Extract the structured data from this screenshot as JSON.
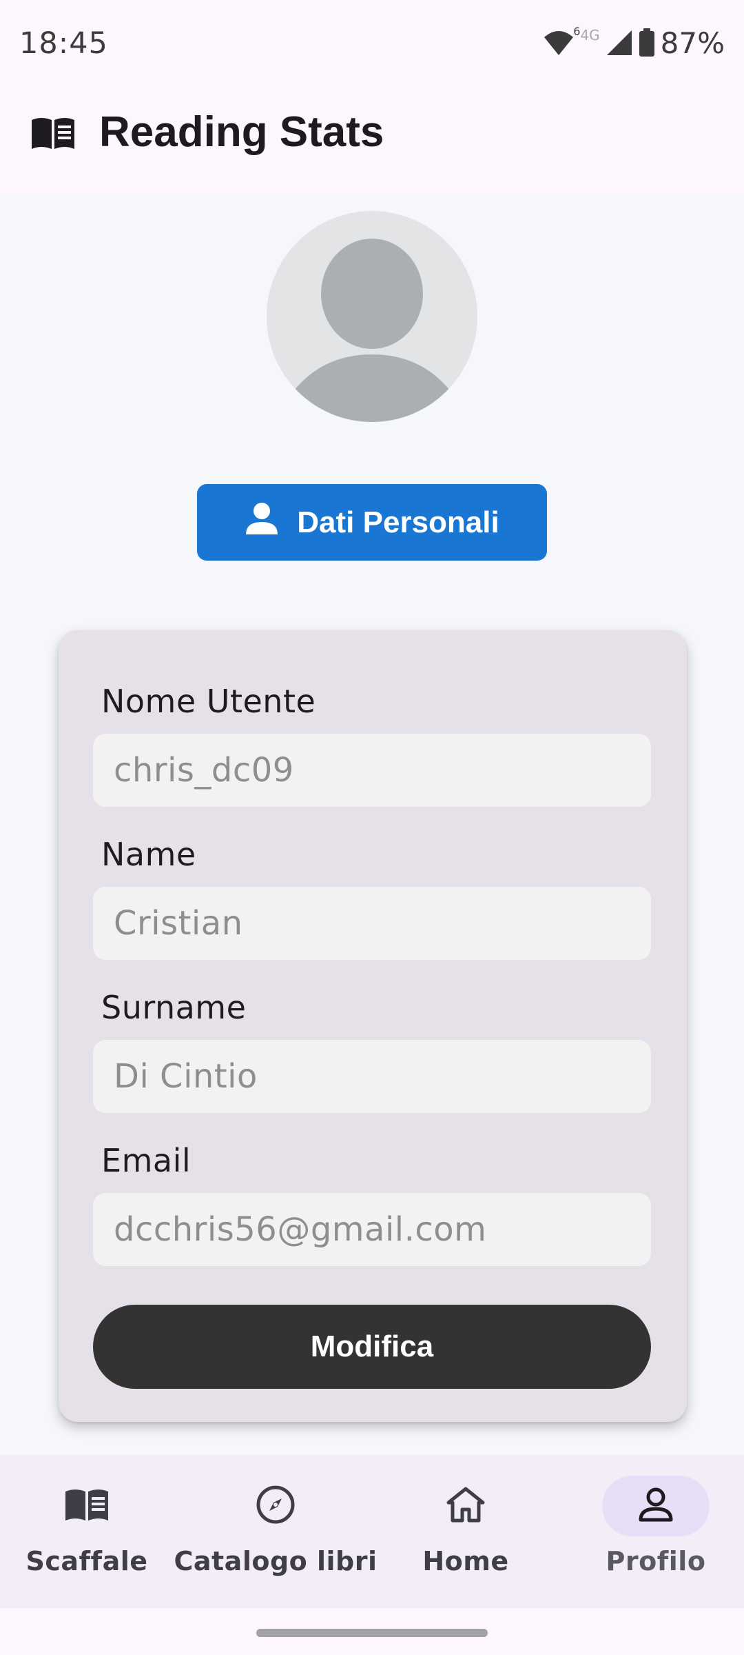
{
  "status_bar": {
    "time": "18:45",
    "wifi_badge": "6",
    "network": "4G",
    "battery": "87%"
  },
  "app_bar": {
    "title": "Reading Stats",
    "icon": "open-book-icon"
  },
  "profile": {
    "avatar_icon": "person-placeholder-icon",
    "personal_button_label": "Dati Personali",
    "personal_button_icon": "person-icon"
  },
  "form": {
    "fields": [
      {
        "label": "Nome Utente",
        "value": "chris_dc09"
      },
      {
        "label": "Name",
        "value": "Cristian"
      },
      {
        "label": "Surname",
        "value": "Di Cintio"
      },
      {
        "label": "Email",
        "value": "dcchris56@gmail.com"
      }
    ],
    "submit_label": "Modifica"
  },
  "bottom_nav": {
    "items": [
      {
        "label": "Scaffale",
        "icon": "book-icon",
        "active": false
      },
      {
        "label": "Catalogo libri",
        "icon": "compass-icon",
        "active": false
      },
      {
        "label": "Home",
        "icon": "home-icon",
        "active": false
      },
      {
        "label": "Profilo",
        "icon": "person-outline-icon",
        "active": true
      }
    ]
  },
  "colors": {
    "primary_button": "#1976D2",
    "dark_button": "#333333",
    "active_nav_pill": "#E8DEF8",
    "card_background": "#E6E0E8"
  }
}
